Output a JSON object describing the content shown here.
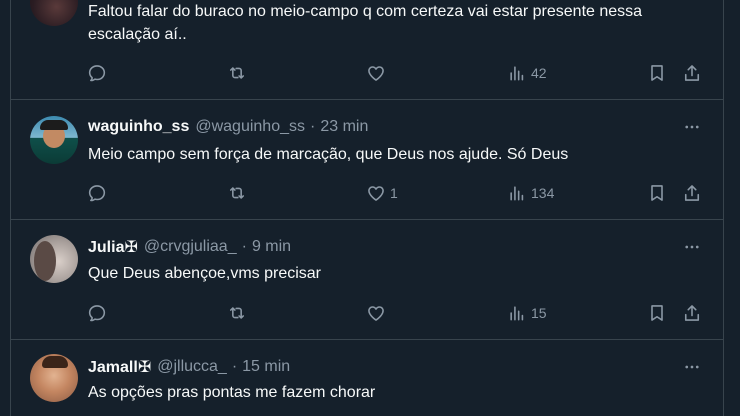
{
  "tweets": [
    {
      "name": "",
      "handle": "",
      "time": "",
      "text": "Faltou falar do buraco no meio-campo q com certeza vai estar presente nessa escalação aí..",
      "replies": "",
      "retweets": "",
      "likes": "",
      "views": "42"
    },
    {
      "name": "waguinho_ss",
      "handle": "@waguinho_ss",
      "dot": "·",
      "time": "23 min",
      "text": "Meio campo sem força de marcação,  que Deus nos ajude. Só Deus",
      "replies": "",
      "retweets": "",
      "likes": "1",
      "views": "134"
    },
    {
      "name": "Julia✠",
      "handle": "@crvgjuliaa_",
      "dot": "·",
      "time": "9 min",
      "text": "Que Deus abençoe,vms precisar",
      "replies": "",
      "retweets": "",
      "likes": "",
      "views": "15"
    },
    {
      "name": "Jamall✠",
      "handle": "@jllucca_",
      "dot": "·",
      "time": "15 min",
      "text": "As opções pras pontas me fazem chorar"
    }
  ],
  "icons": {
    "reply": "reply-icon",
    "retweet": "retweet-icon",
    "like": "heart-icon",
    "views": "views-icon",
    "bookmark": "bookmark-icon",
    "share": "share-icon",
    "more": "more-icon"
  },
  "colors": {
    "background": "#15202b",
    "border": "#38444d",
    "secondary_text": "#8b98a5",
    "primary_text": "#f7f9f9"
  }
}
